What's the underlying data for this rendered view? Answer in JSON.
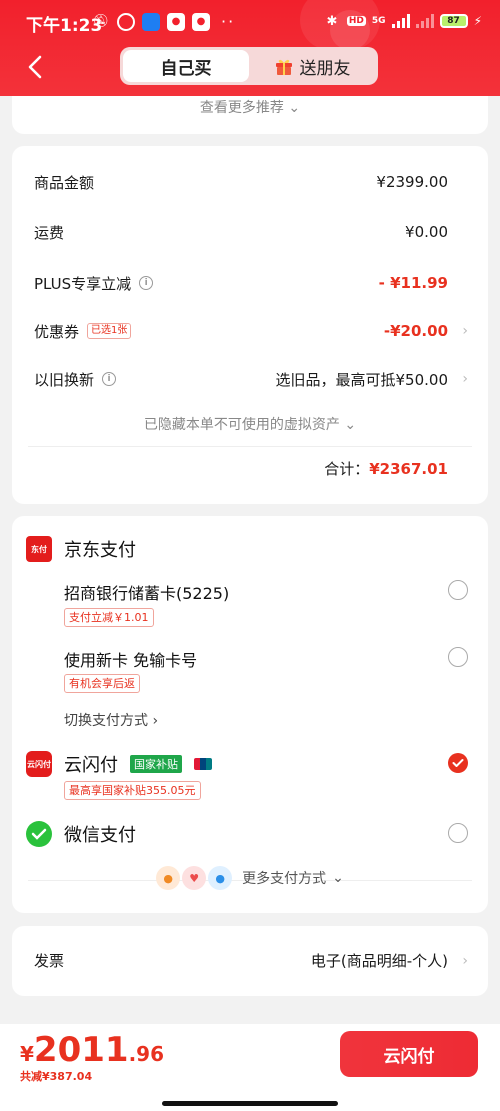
{
  "status_bar": {
    "time": "下午1:23",
    "net": "5G",
    "battery": "87"
  },
  "tabs": [
    {
      "label": "自己买",
      "active": true
    },
    {
      "label": "送朋友",
      "active": false
    }
  ],
  "more_recommend": "查看更多推荐",
  "amounts": {
    "goods_label": "商品金额",
    "goods_value": "¥2399.00",
    "shipping_label": "运费",
    "shipping_value": "¥0.00",
    "plus_label": "PLUS专享立减",
    "plus_value": "- ¥11.99",
    "coupon_label": "优惠券",
    "coupon_tag": "已选1张",
    "coupon_value": "-¥20.00",
    "tradein_label": "以旧换新",
    "tradein_value": "选旧品，最高可抵¥50.00",
    "hidden_note": "已隐藏本单不可使用的虚拟资产",
    "total_label": "合计：",
    "total_value": "¥2367.01"
  },
  "payment": {
    "jd_pay": "京东支付",
    "jd_logo_text": "东付",
    "cmb_card": "招商银行储蓄卡(5225)",
    "cmb_promo": "支付立减￥1.01",
    "new_card": "使用新卡 免输卡号",
    "new_card_promo": "有机会享后返",
    "switch": "切换支付方式",
    "unionpay": "云闪付",
    "unionpay_logo_text": "云闪付",
    "unionpay_tag": "国家补贴",
    "unionpay_promo": "最高享国家补贴355.05元",
    "wechat": "微信支付",
    "more_methods": "更多支付方式"
  },
  "invoice": {
    "label": "发票",
    "value": "电子(商品明细-个人)"
  },
  "bottom": {
    "currency": "¥",
    "price_int": "2011",
    "price_dec": ".96",
    "saved": "共减¥387.04",
    "pay_button": "云闪付"
  },
  "colors": {
    "brand_red": "#f2202c",
    "price_red": "#e8311f",
    "green": "#1fa64a"
  }
}
